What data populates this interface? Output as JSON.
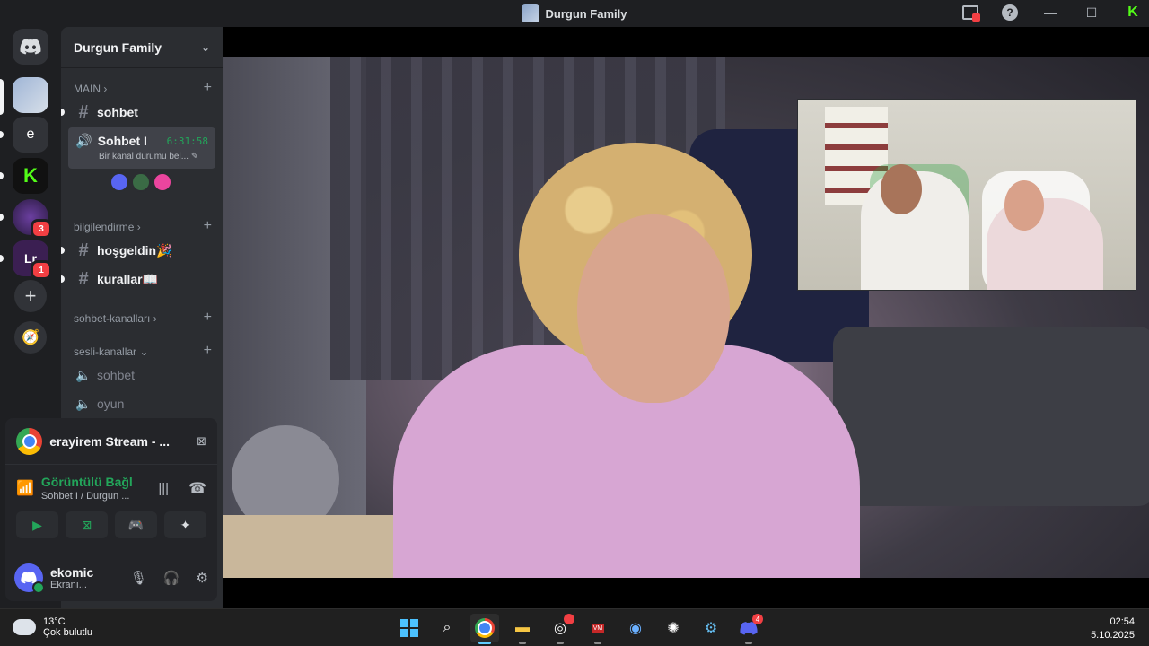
{
  "window": {
    "title": "Durgun Family"
  },
  "servers": {
    "home_icon": "discord-icon",
    "items": [
      {
        "name": "durgun-family-server",
        "label": ""
      },
      {
        "name": "e-server",
        "label": "e"
      },
      {
        "name": "kick-server",
        "label": "K"
      },
      {
        "name": "purple-server",
        "label": "",
        "badge": "3"
      },
      {
        "name": "lr-server",
        "label": "",
        "badge": "1"
      }
    ]
  },
  "sidebar": {
    "guild_name": "Durgun Family",
    "categories": {
      "main": "MAIN",
      "bilgilendirme": "bilgilendirme",
      "sohbet_kanallari": "sohbet-kanalları",
      "sesli_kanallar": "sesli-kanallar"
    },
    "channels": {
      "sohbet_text": "sohbet",
      "hosgeldin": "hoşgeldin🎉",
      "kurallar": "kurallar📖",
      "voice_sohbet": "sohbet",
      "voice_oyun": "oyun"
    },
    "active_voice": {
      "name": "Sohbet I",
      "timer": "6:31:58",
      "status": "Bir kanal durumu bel..."
    }
  },
  "panel": {
    "stream_title": "erayirem Stream - ...",
    "connection_label": "Görüntülü Bağl",
    "connection_sub": "Sohbet I / Durgun ...",
    "user": {
      "name": "ekomic",
      "status": "Ekranı..."
    }
  },
  "taskbar": {
    "weather_temp": "13°C",
    "weather_desc": "Çok bulutlu",
    "time": "02:54",
    "date": "5.10.2025",
    "discord_badge": "4"
  },
  "colors": {
    "accent": "#5865f2",
    "online": "#23a55a",
    "danger": "#f23f43",
    "kick": "#53fc18"
  }
}
